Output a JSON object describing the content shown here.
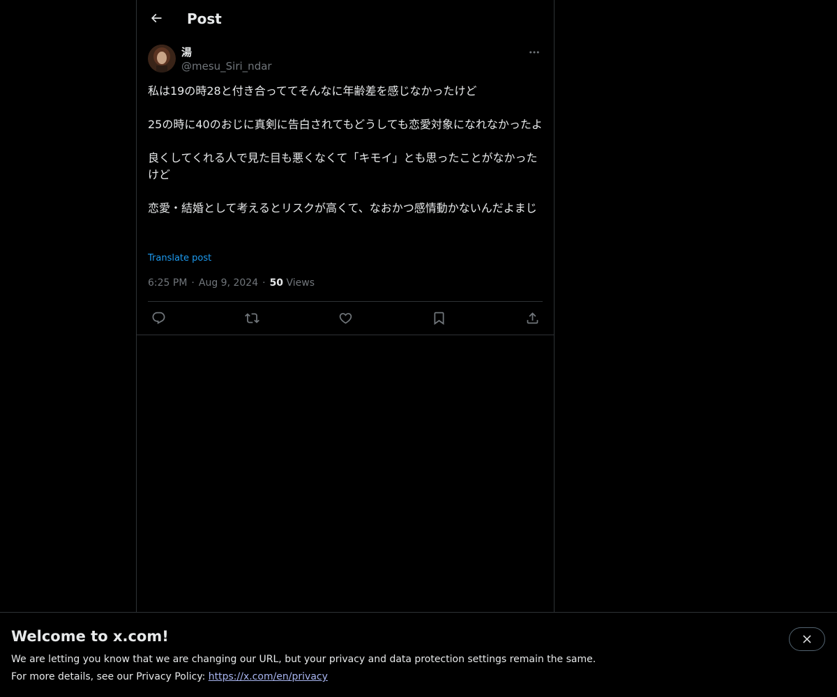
{
  "header": {
    "title": "Post"
  },
  "post": {
    "author": {
      "display_name": "湯",
      "handle": "@mesu_Siri_ndar"
    },
    "paragraphs": [
      "私は19の時28と付き合っててそんなに年齢差を感じなかったけど",
      "25の時に40のおじに真剣に告白されてもどうしても恋愛対象になれなかったよ",
      "良くしてくれる人で見た目も悪くなくて「キモイ」とも思ったことがなかったけど",
      "恋愛・結婚として考えるとリスクが高くて、なおかつ感情動かないんだよまじ"
    ],
    "translate_label": "Translate post",
    "time": "6:25 PM",
    "date": "Aug 9, 2024",
    "separator": "·",
    "views_count": "50",
    "views_label": "Views"
  },
  "banner": {
    "title": "Welcome to x.com!",
    "line1": "We are letting you know that we are changing our URL, but your privacy and data protection settings remain the same.",
    "line2_prefix": "For more details, see our Privacy Policy: ",
    "link_text": "https://x.com/en/privacy"
  },
  "colors": {
    "background": "#000000",
    "text_primary": "#e7e9ea",
    "text_secondary": "#71767b",
    "accent": "#1d9bf0",
    "border": "#2f3336"
  },
  "icons": {
    "back": "arrow-left-icon",
    "more": "more-horizontal-icon",
    "reply": "reply-icon",
    "repost": "repost-icon",
    "like": "heart-icon",
    "bookmark": "bookmark-icon",
    "share": "share-icon",
    "close": "close-icon"
  }
}
